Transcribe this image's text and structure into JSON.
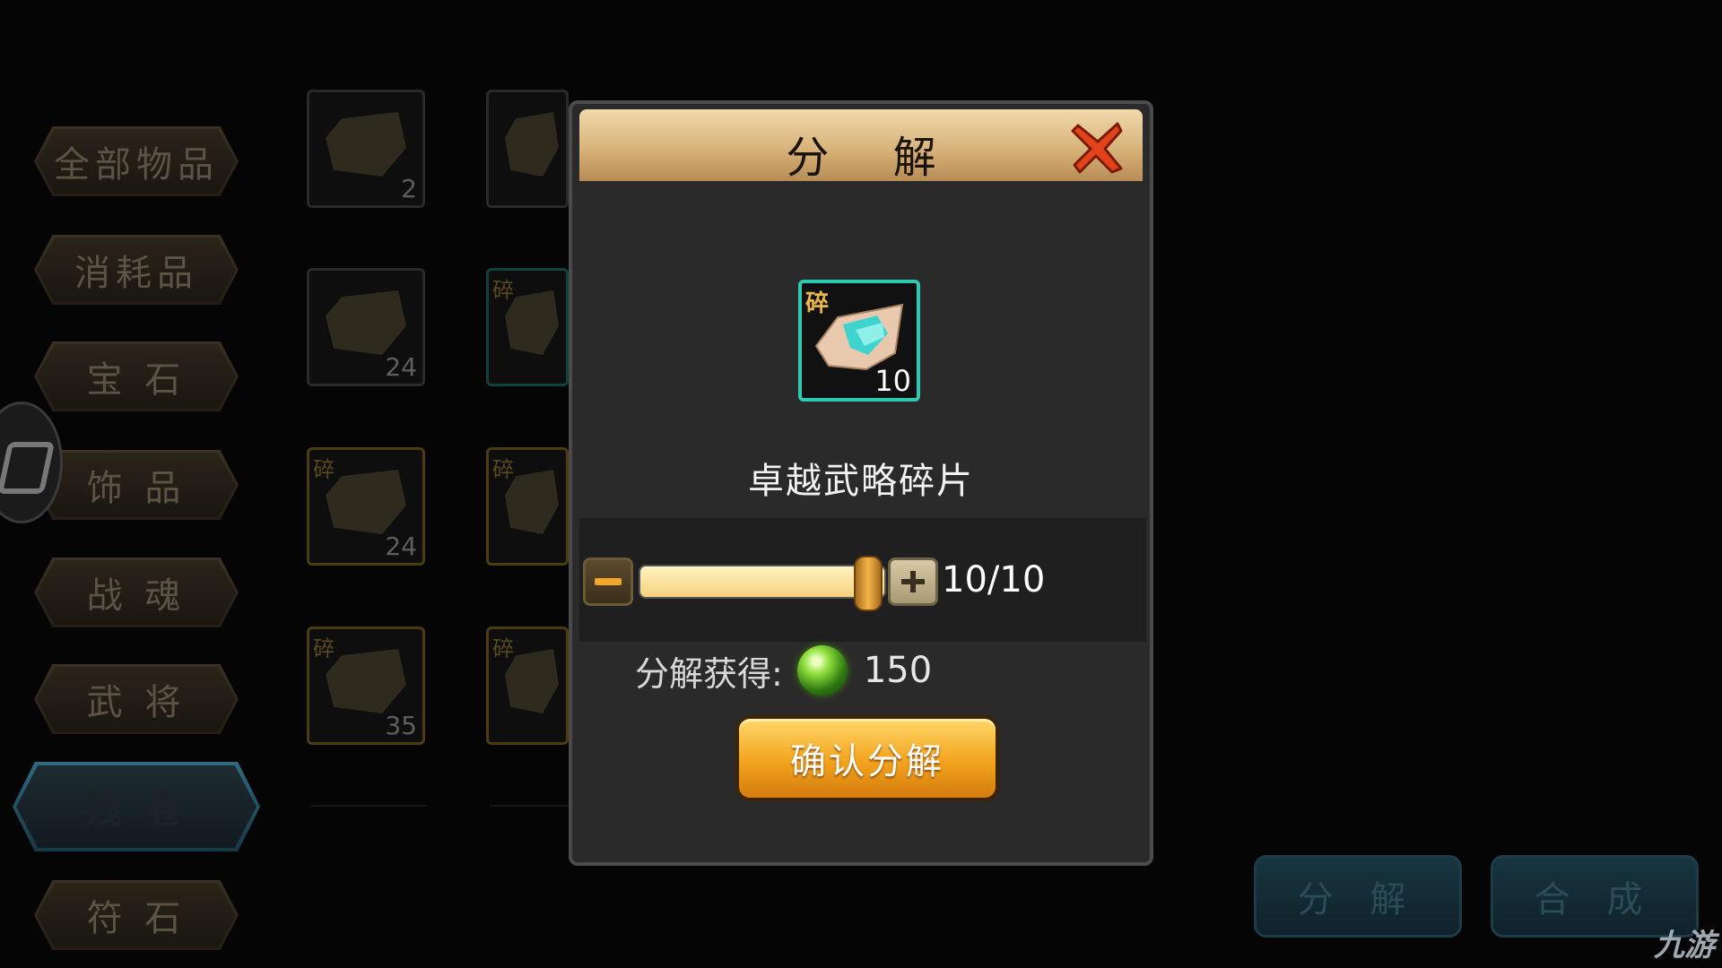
{
  "sidebar": {
    "categories": [
      {
        "label": "全部物品",
        "active": false
      },
      {
        "label": "消耗品",
        "active": false
      },
      {
        "label": "宝 石",
        "active": false
      },
      {
        "label": "饰 品",
        "active": false
      },
      {
        "label": "战 魂",
        "active": false
      },
      {
        "label": "武 将",
        "active": false
      },
      {
        "label": "残 卷",
        "active": true
      },
      {
        "label": "符 石",
        "active": false
      }
    ]
  },
  "inventory": {
    "fragment_tag": "碎",
    "slots": [
      {
        "count": "2",
        "tagged": false
      },
      {
        "count": "",
        "tagged": false
      },
      {
        "count": "24",
        "tagged": false
      },
      {
        "count": "",
        "tagged": true
      },
      {
        "count": "24",
        "tagged": true
      },
      {
        "count": "",
        "tagged": true
      },
      {
        "count": "35",
        "tagged": true
      },
      {
        "count": "",
        "tagged": true
      }
    ]
  },
  "dialog": {
    "title": "分 解",
    "close_icon": "close-x-icon",
    "item": {
      "tag": "碎",
      "count": "10",
      "name": "卓越武略碎片",
      "border_color": "#2fc9b3"
    },
    "slider": {
      "quantity_text": "10/10",
      "value": 10,
      "max": 10
    },
    "reward": {
      "label": "分解获得:",
      "icon": "green-orb-icon",
      "value": "150"
    },
    "confirm_label": "确认分解"
  },
  "bottom_buttons": {
    "decompose_label": "分 解",
    "synthesize_label": "合 成"
  },
  "watermark": "九游"
}
